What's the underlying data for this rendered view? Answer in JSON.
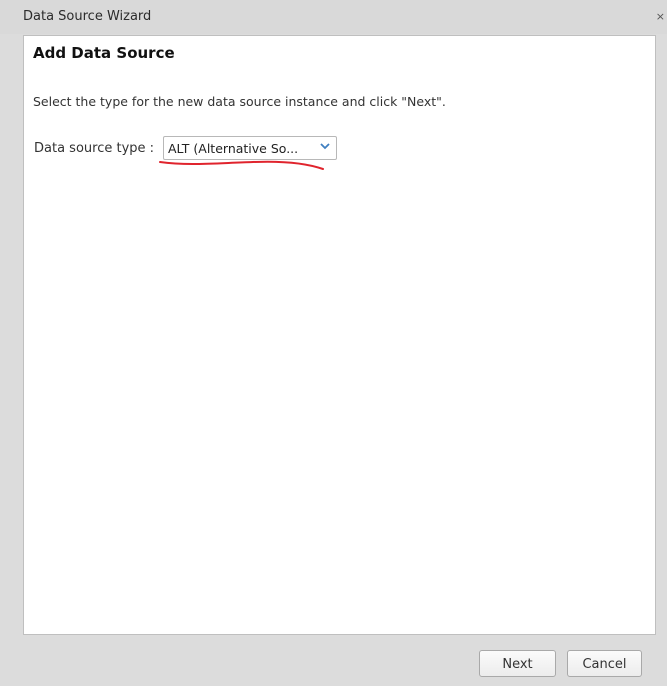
{
  "window": {
    "title": "Data Source Wizard",
    "close_glyph": "×"
  },
  "page": {
    "title": "Add Data Source",
    "instruction": "Select the type for the new data source instance and click \"Next\"."
  },
  "form": {
    "data_source_type_label": "Data source type :",
    "data_source_type_value": "ALT (Alternative So...",
    "annotation_color": "#e0242d"
  },
  "footer": {
    "next_label": "Next",
    "cancel_label": "Cancel"
  }
}
